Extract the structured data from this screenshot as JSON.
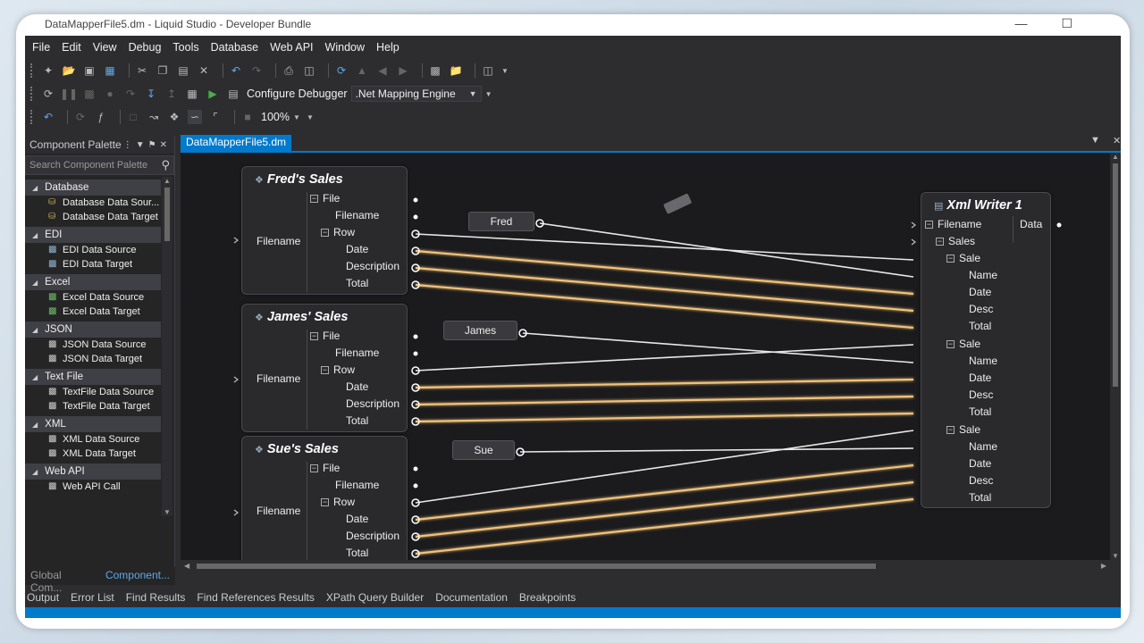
{
  "window": {
    "title": "DataMapperFile5.dm - Liquid Studio - Developer Bundle",
    "min_icon": "minimize-icon",
    "max_icon": "maximize-icon"
  },
  "menu": [
    "File",
    "Edit",
    "View",
    "Debug",
    "Tools",
    "Database",
    "Web API",
    "Window",
    "Help"
  ],
  "toolbar2": {
    "configure_label": "Configure Debugger",
    "engine_value": ".Net Mapping Engine"
  },
  "toolbar3": {
    "zoom_value": "100%"
  },
  "palette": {
    "title": "Component Palette",
    "search_placeholder": "Search Component Palette",
    "categories": [
      {
        "name": "Database",
        "items": [
          "Database Data Sour...",
          "Database Data Target"
        ]
      },
      {
        "name": "EDI",
        "items": [
          "EDI Data Source",
          "EDI Data Target"
        ]
      },
      {
        "name": "Excel",
        "items": [
          "Excel Data Source",
          "Excel Data Target"
        ]
      },
      {
        "name": "JSON",
        "items": [
          "JSON Data Source",
          "JSON Data Target"
        ]
      },
      {
        "name": "Text File",
        "items": [
          "TextFile Data Source",
          "TextFile Data Target"
        ]
      },
      {
        "name": "XML",
        "items": [
          "XML Data Source",
          "XML Data Target"
        ]
      },
      {
        "name": "Web API",
        "items": [
          "Web API Call"
        ]
      }
    ],
    "tabs": [
      "Global Com...",
      "Component..."
    ]
  },
  "document": {
    "tab_label": "DataMapperFile5.dm"
  },
  "sources": [
    {
      "title": "Fred's Sales",
      "filename_label": "Filename",
      "rows": [
        "File",
        "Filename",
        "Row",
        "Date",
        "Description",
        "Total"
      ]
    },
    {
      "title": "James' Sales",
      "filename_label": "Filename",
      "rows": [
        "File",
        "Filename",
        "Row",
        "Date",
        "Description",
        "Total"
      ]
    },
    {
      "title": "Sue's Sales",
      "filename_label": "Filename",
      "rows": [
        "File",
        "Filename",
        "Row",
        "Date",
        "Description",
        "Total"
      ]
    }
  ],
  "constants": [
    "Fred",
    "James",
    "Sue"
  ],
  "writer": {
    "title": "Xml Writer 1",
    "data_label": "Data",
    "rows": [
      "Filename",
      "Sales",
      "Sale",
      "Name",
      "Date",
      "Desc",
      "Total",
      "Sale",
      "Name",
      "Date",
      "Desc",
      "Total",
      "Sale",
      "Name",
      "Date",
      "Desc",
      "Total"
    ]
  },
  "bottom_tabs": [
    "Output",
    "Error List",
    "Find Results",
    "Find References Results",
    "XPath Query Builder",
    "Documentation",
    "Breakpoints"
  ]
}
